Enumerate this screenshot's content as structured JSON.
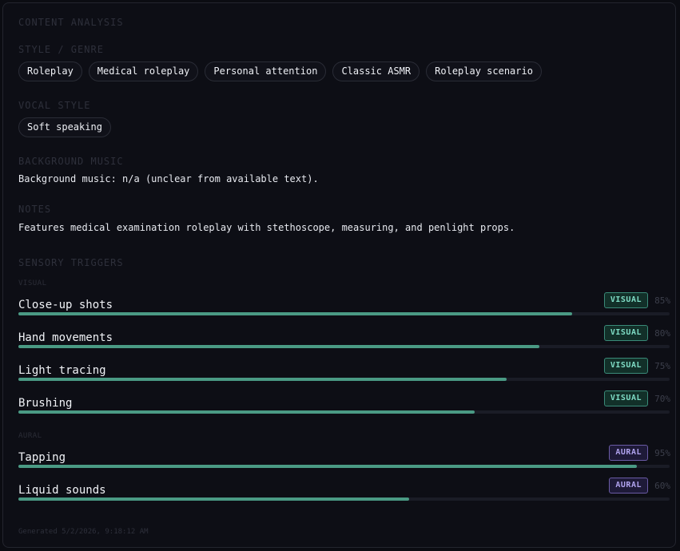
{
  "header": {
    "title": "CONTENT ANALYSIS"
  },
  "style_genre": {
    "title": "STYLE / GENRE",
    "tags": [
      "Roleplay",
      "Medical roleplay",
      "Personal attention",
      "Classic ASMR",
      "Roleplay scenario"
    ]
  },
  "vocal_style": {
    "title": "VOCAL STYLE",
    "tags": [
      "Soft speaking"
    ]
  },
  "background_music": {
    "title": "BACKGROUND MUSIC",
    "text": "Background music: n/a (unclear from available text)."
  },
  "notes": {
    "title": "NOTES",
    "text": "Features medical examination roleplay with stethoscope, measuring, and penlight props."
  },
  "sensory_triggers": {
    "title": "SENSORY TRIGGERS",
    "visual_label": "VISUAL",
    "aural_label": "AURAL",
    "visual": [
      {
        "name": "Close-up shots",
        "badge": "VISUAL",
        "pct_text": "85%",
        "value": 0.85
      },
      {
        "name": "Hand movements",
        "badge": "VISUAL",
        "pct_text": "80%",
        "value": 0.8
      },
      {
        "name": "Light tracing",
        "badge": "VISUAL",
        "pct_text": "75%",
        "value": 0.75
      },
      {
        "name": "Brushing",
        "badge": "VISUAL",
        "pct_text": "70%",
        "value": 0.7
      }
    ],
    "aural": [
      {
        "name": "Tapping",
        "badge": "AURAL",
        "pct_text": "95%",
        "value": 0.95
      },
      {
        "name": "Liquid sounds",
        "badge": "AURAL",
        "pct_text": "60%",
        "value": 0.6
      }
    ]
  },
  "footer": {
    "generated": "Generated 5/2/2026, 9:18:12 AM"
  },
  "colors": {
    "visual_accent": "#7fdcc5",
    "aural_accent": "#b0a3ee",
    "bar_fill": "#4a9a84"
  }
}
